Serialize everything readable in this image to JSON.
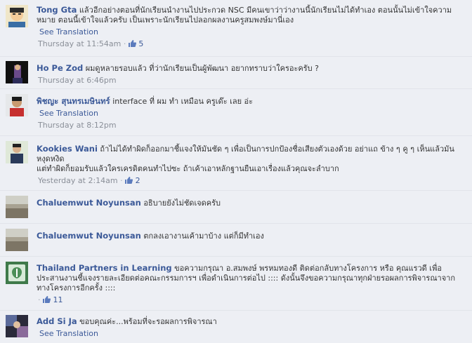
{
  "comments": [
    {
      "name": "Tong Gta",
      "text": "แล้วอีกอย่างตอนที่นักเรียนนำงานไปประกวด NSC มีคนเขาว่าว่างานนี้นักเรียนไม่ได้ทำเอง ตอนนั้นไม่เข้าใจความหมาย ตอนนี้เข้าใจแล้วครับ เป็นเพราะนักเรียนไปลอกผลงานครูสมพงษ์มานี่เอง",
      "see_translation": "See Translation",
      "time": "Thursday at 11:54am",
      "likes": "5"
    },
    {
      "name": "Ho Pe Zod",
      "text": "ผมดูหลายรอบแล้ว ที่ว่านักเรียนเป็นผู้พัฒนา อยากทราบว่าใครอะครับ ?",
      "time": "Thursday at 6:46pm"
    },
    {
      "name": "พิชญะ สุนทรเมษินทร์",
      "text": "interface ที่ ผม ทำ เหมือน ครูเด๊ะ เลย อ่ะ",
      "see_translation": "See Translation",
      "time": "Thursday at 8:12pm"
    },
    {
      "name": "Kookies Wani",
      "text": "ถ้าไม่ได้ทำผิดก็ออกมาชี้แจงให้มันชัด ๆ เพื่อเป็นการปกป้องชื่อเสียงตัวเองด้วย อย่าแถ ข้าง ๆ คู ๆ เห็นแล้วมันหงุดหงิด",
      "text2": "แต่ทำผิดก็ยอมรับแล้วใครเครดิตคนทำไปซะ ถ้าเค้าเอาหลักฐานยืนเอาเรื่องแล้วคุณจะลำบาก",
      "time": "Yesterday at 2:14am",
      "likes": "2"
    },
    {
      "name": "Chaluemwut Noyunsan",
      "text": "อธิบายยังไม่ชัดเจดครับ"
    },
    {
      "name": "Chaluemwut Noyunsan",
      "text": "ตกลงเอางานเค้ามาบ้าง แต่ก็มีทำเอง"
    },
    {
      "name": "Thailand Partners in Learning",
      "text": "ขอความกรุณา อ.สมพงษ์ พรหมทองดี ติดต่อกลับทางโครงการ หรือ คุณแรวดี เพื่อประสานงานชี้แจงรายละเอียดต่อคณะกรรมการฯ เพื่อดำเนินการต่อไป :::: ดังนั้นจึงขอความกรุณาทุกฝ่ายรอผลการพิจารณาจากทางโครงการอีกครั้ง ::::",
      "likes": "11"
    },
    {
      "name": "Add Si Ja",
      "text": "ขอบคุณค่ะ...พร้อมที่จะรอผลการพิจารณา",
      "see_translation": "See Translation"
    }
  ],
  "meta_separator": "·",
  "colors": {
    "link": "#3b5998",
    "meta": "#8a8f98",
    "background": "#edeff4"
  }
}
